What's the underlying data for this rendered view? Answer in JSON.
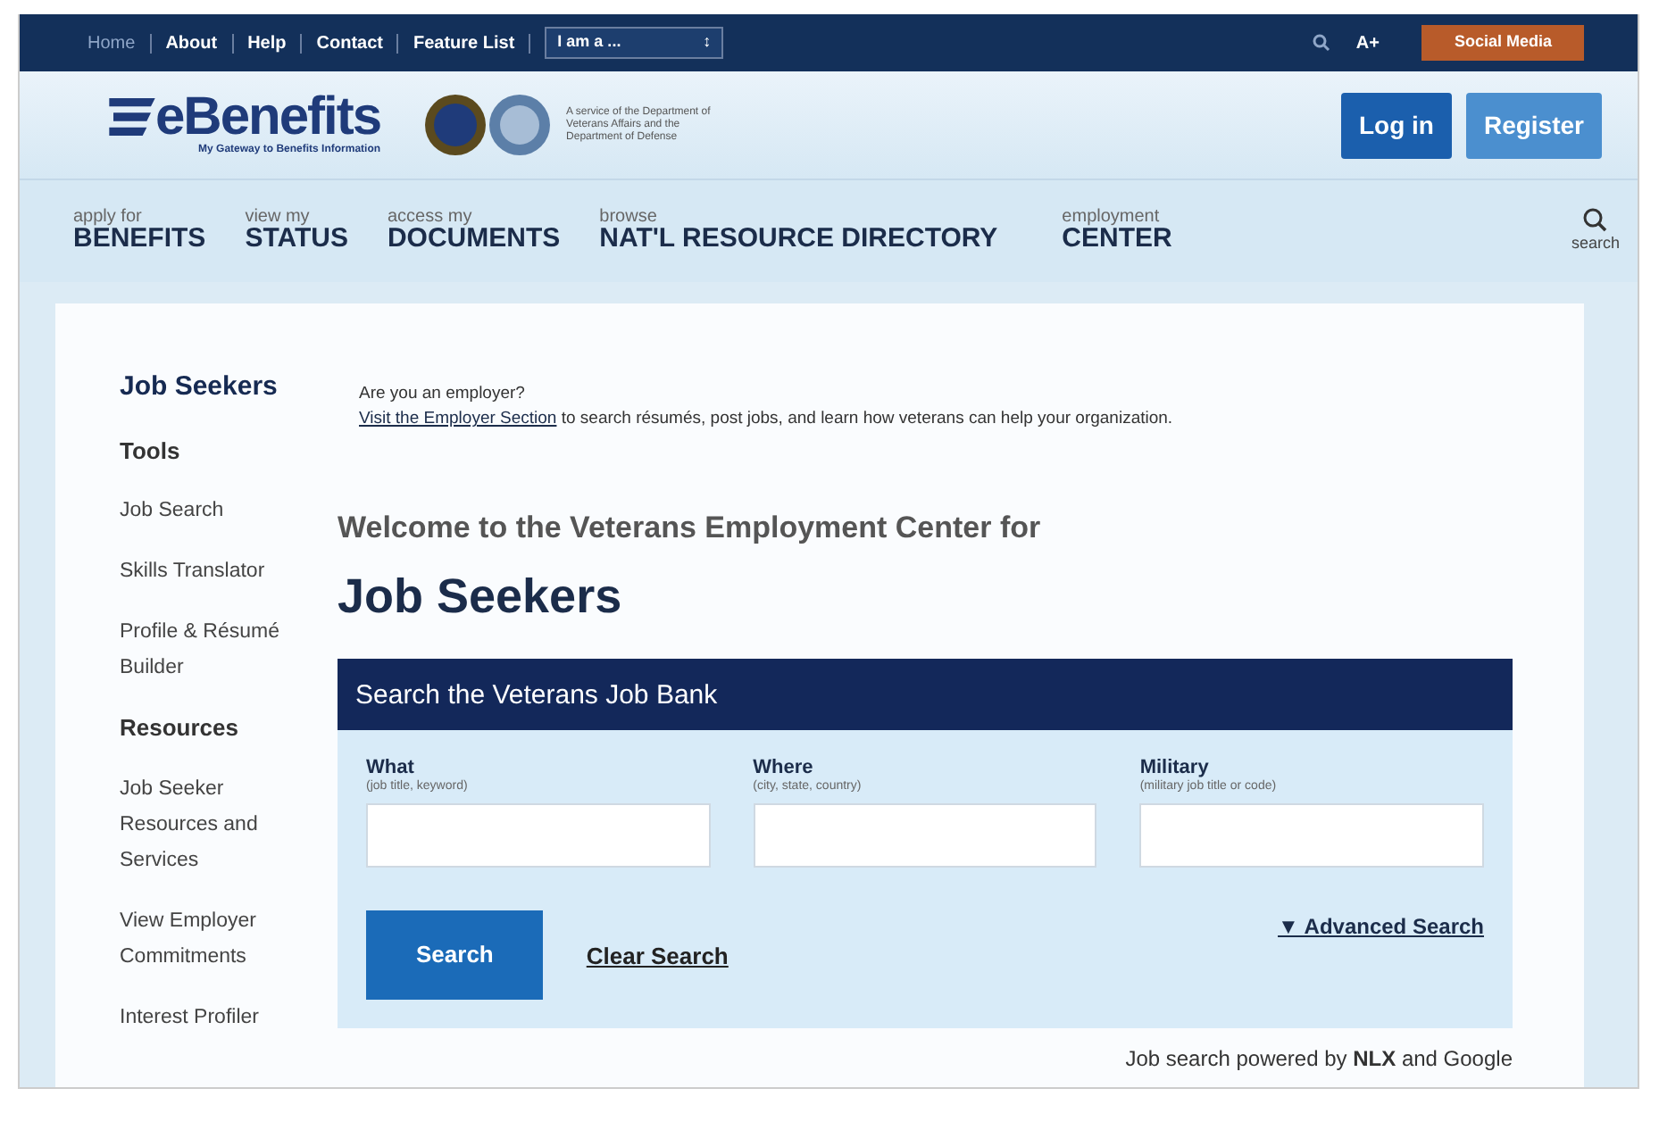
{
  "top_bar": {
    "links": [
      {
        "label": "Home",
        "selected": true
      },
      {
        "label": "About",
        "selected": false
      },
      {
        "label": "Help",
        "selected": false
      },
      {
        "label": "Contact",
        "selected": false
      },
      {
        "label": "Feature List",
        "selected": false
      }
    ],
    "role_select": {
      "value": "I am a ...",
      "caret": "↕"
    },
    "text_size": "A+",
    "social": "Social Media"
  },
  "header": {
    "logo": "eBenefits",
    "tagline": "My Gateway to Benefits Information",
    "service_note": "A service of the Department of Veterans Affairs and the Department of Defense",
    "buttons": [
      "Log in",
      "Register"
    ]
  },
  "nav": {
    "items": [
      {
        "small": "apply for",
        "big": "BENEFITS"
      },
      {
        "small": "view my",
        "big": "STATUS"
      },
      {
        "small": "access my",
        "big": "DOCUMENTS"
      },
      {
        "small": "browse",
        "big": "NAT'L RESOURCE DIRECTORY"
      },
      {
        "small": "employment",
        "big": "CENTER"
      }
    ],
    "search_label": "search"
  },
  "sidebar": {
    "items": [
      {
        "kind": "title",
        "label": "Job Seekers"
      },
      {
        "kind": "heading",
        "label": "Tools"
      },
      {
        "kind": "link",
        "label": "Job Search"
      },
      {
        "kind": "link",
        "label": "Skills Translator"
      },
      {
        "kind": "link",
        "label": "Profile & Résumé Builder"
      },
      {
        "kind": "heading",
        "label": "Resources"
      },
      {
        "kind": "link",
        "label": "Job Seeker Resources and Services"
      },
      {
        "kind": "link",
        "label": "View Employer Commitments"
      },
      {
        "kind": "link",
        "label": "Interest Profiler"
      }
    ]
  },
  "employer": {
    "question": "Are you an employer?",
    "link": "Visit the Employer Section",
    "rest": "to search résumés, post jobs, and learn how veterans can help your organization."
  },
  "welcome": "Welcome to the Veterans Employment Center for",
  "heading": "Job Seekers",
  "search_panel": {
    "title": "Search the Veterans Job Bank",
    "fields": [
      {
        "label": "What",
        "hint": "(job title, keyword)"
      },
      {
        "label": "Where",
        "hint": "(city, state, country)"
      },
      {
        "label": "Military",
        "hint": "(military job title or code)"
      }
    ],
    "search_button": "Search",
    "clear_link": "Clear Search",
    "advanced_link": "▼ Advanced Search"
  },
  "powered": "Job search powered by **NLX** and Google"
}
